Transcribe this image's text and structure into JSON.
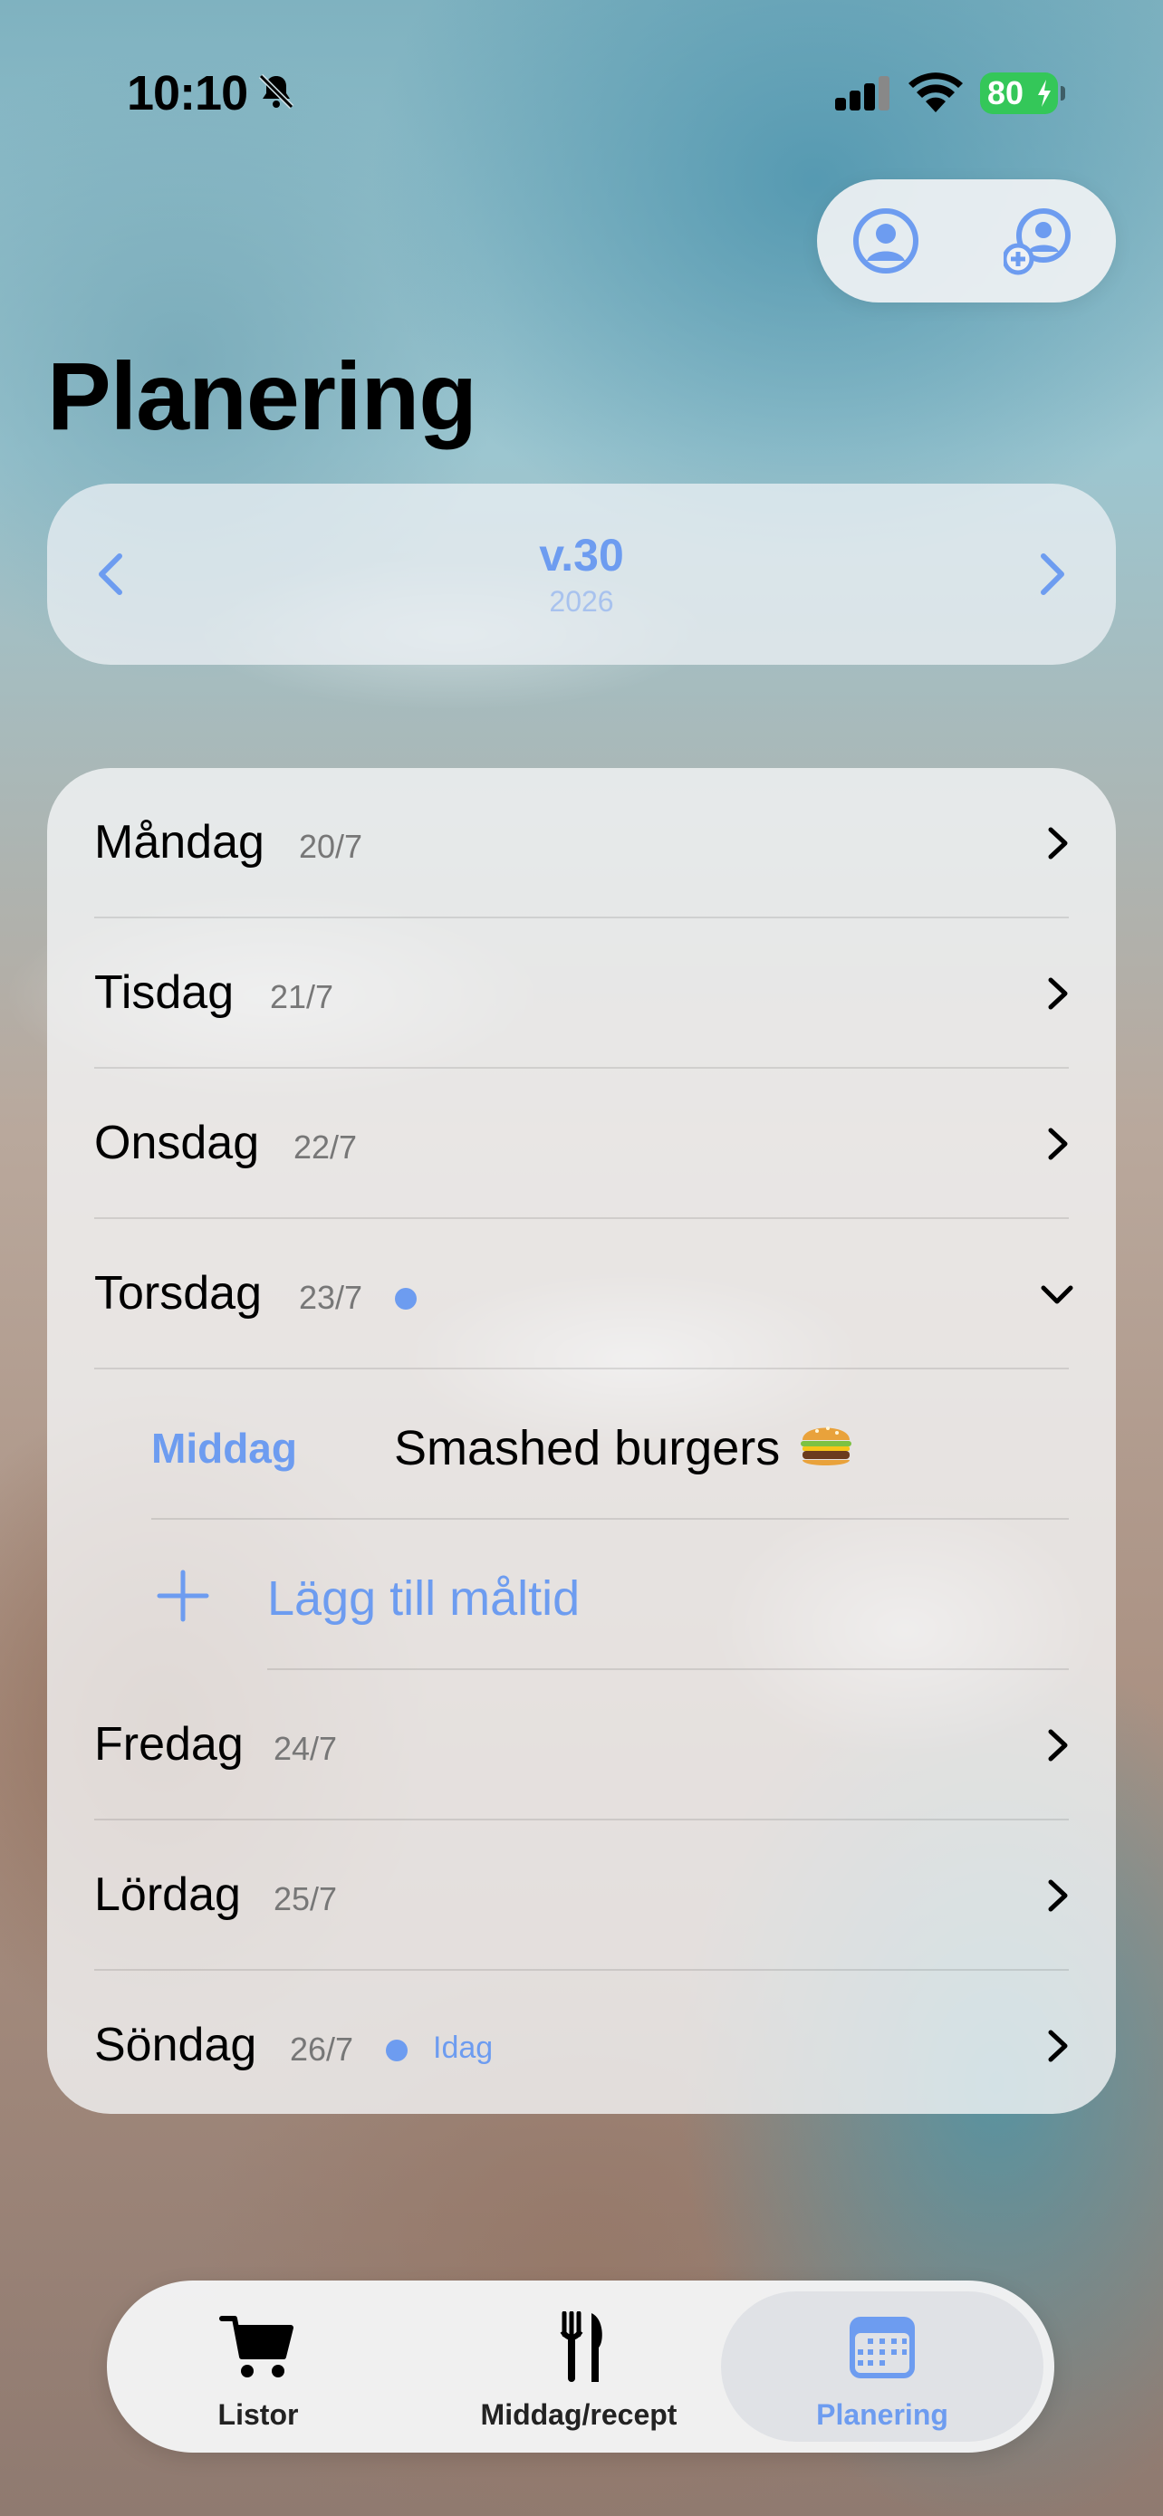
{
  "status": {
    "time": "10:10",
    "battery": "80"
  },
  "header": {
    "title": "Planering"
  },
  "week": {
    "label": "v.30",
    "year": "2026"
  },
  "days": [
    {
      "name": "Måndag",
      "date": "20/7"
    },
    {
      "name": "Tisdag",
      "date": "21/7"
    },
    {
      "name": "Onsdag",
      "date": "22/7"
    },
    {
      "name": "Torsdag",
      "date": "23/7"
    },
    {
      "name": "Fredag",
      "date": "24/7"
    },
    {
      "name": "Lördag",
      "date": "25/7"
    },
    {
      "name": "Söndag",
      "date": "26/7",
      "badge": "Idag"
    }
  ],
  "expanded_day": {
    "meals": [
      {
        "type": "Middag",
        "name": "Smashed burgers"
      }
    ],
    "add_label": "Lägg till måltid"
  },
  "tabs": [
    {
      "label": "Listor"
    },
    {
      "label": "Middag/recept"
    },
    {
      "label": "Planering"
    }
  ],
  "colors": {
    "accent": "#6d9cf0"
  }
}
